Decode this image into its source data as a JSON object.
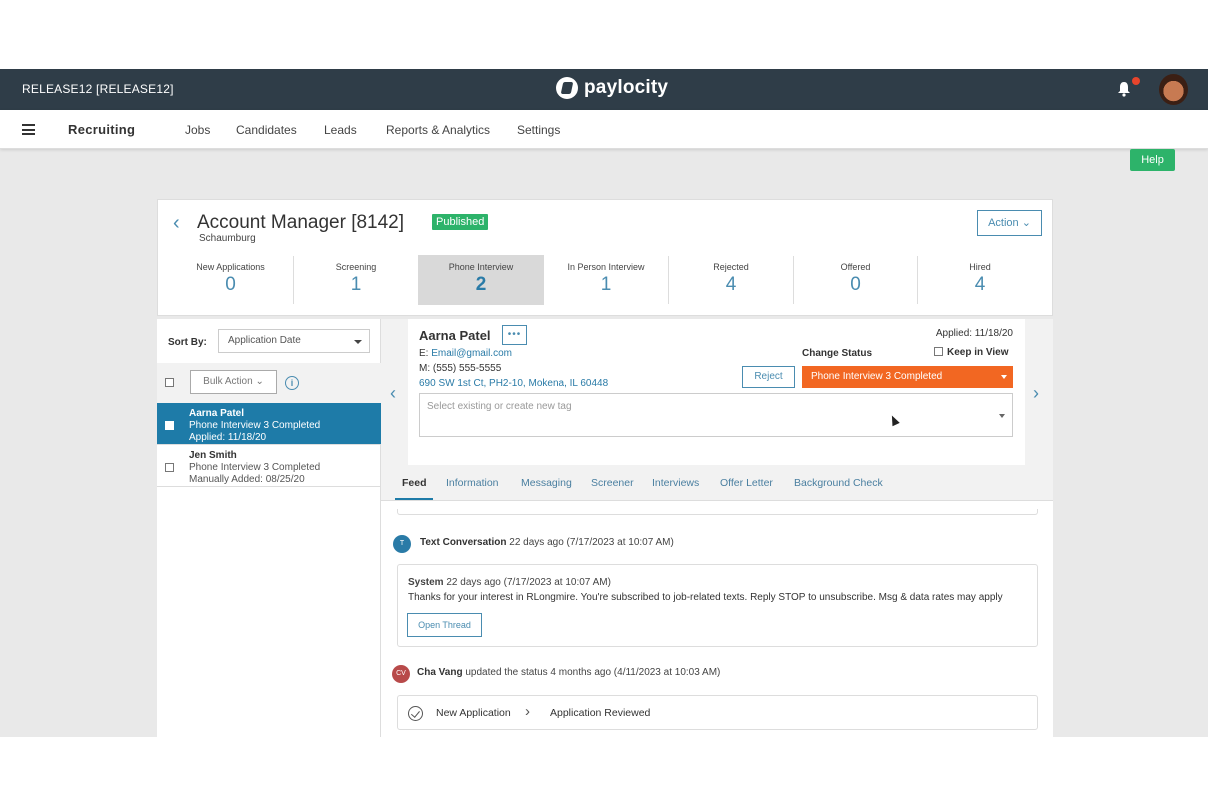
{
  "topbar": {
    "release": "RELEASE12 [RELEASE12]",
    "logo_text": "paylocity",
    "bell_icon": "bell-icon",
    "brand_color": "#2f3d48"
  },
  "nav": {
    "brand": "Recruiting",
    "items": [
      "Jobs",
      "Candidates",
      "Leads",
      "Reports & Analytics",
      "Settings"
    ]
  },
  "help_label": "Help",
  "job": {
    "title": "Account Manager [8142]",
    "location": "Schaumburg",
    "badge": "Published",
    "action_label": "Action",
    "pipeline": [
      {
        "label": "New Applications",
        "count": "0"
      },
      {
        "label": "Screening",
        "count": "1"
      },
      {
        "label": "Phone Interview",
        "count": "2"
      },
      {
        "label": "In Person Interview",
        "count": "1"
      },
      {
        "label": "Rejected",
        "count": "4"
      },
      {
        "label": "Offered",
        "count": "0"
      },
      {
        "label": "Hired",
        "count": "4"
      }
    ]
  },
  "list": {
    "sort_label": "Sort By:",
    "sort_value": "Application Date",
    "bulk_action": "Bulk Action",
    "candidates": [
      {
        "name": "Aarna Patel",
        "status": "Phone Interview 3 Completed",
        "date": "Applied: 11/18/20"
      },
      {
        "name": "Jen Smith",
        "status": "Phone Interview 3 Completed",
        "date": "Manually Added: 08/25/20"
      }
    ]
  },
  "candidate": {
    "name": "Aarna Patel",
    "more_label": "•••",
    "email_prefix": "E:",
    "email": "Email@gmail.com",
    "phone": "M: (555) 555-5555",
    "address": "690 SW 1st Ct, PH2-10, Mokena, IL 60448",
    "applied": "Applied: 11/18/20",
    "change_status_label": "Change Status",
    "keep_in_view": "Keep in View",
    "reject_label": "Reject",
    "status_value": "Phone Interview 3 Completed",
    "status_color": "#f26722",
    "tag_placeholder": "Select existing or create new tag"
  },
  "tabs": [
    "Feed",
    "Information",
    "Messaging",
    "Screener",
    "Interviews",
    "Offer Letter",
    "Background Check"
  ],
  "feed": {
    "text_conv": {
      "avatar": "T",
      "title": "Text Conversation",
      "time": "22 days ago (7/17/2023 at 10:07 AM)"
    },
    "message": {
      "sender": "System",
      "time": "22 days ago (7/17/2023 at 10:07 AM)",
      "body": "Thanks for your interest in RLongmire. You're subscribed to job-related texts. Reply STOP to unsubscribe. Msg & data rates may apply",
      "button": "Open Thread"
    },
    "status_update": {
      "avatar": "CV",
      "user": "Cha Vang",
      "text": "updated the status 4 months ago (4/11/2023 at 10:03 AM)",
      "from": "New Application",
      "to": "Application Reviewed"
    }
  }
}
